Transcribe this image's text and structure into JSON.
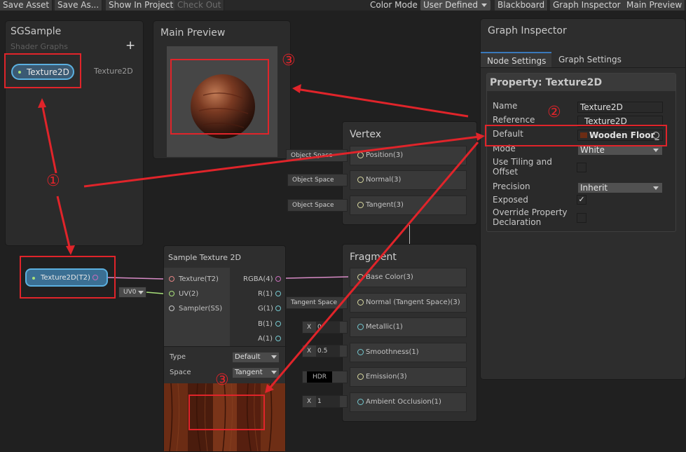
{
  "toolbar": {
    "save_asset": "Save Asset",
    "save_as": "Save As...",
    "show_in_project": "Show In Project",
    "check_out": "Check Out",
    "color_mode_label": "Color Mode",
    "color_mode_value": "User Defined",
    "blackboard": "Blackboard",
    "graph_inspector": "Graph Inspector",
    "main_preview": "Main Preview"
  },
  "blackboard": {
    "title": "SGSample",
    "subtitle": "Shader Graphs",
    "add": "+",
    "property_pill": "Texture2D",
    "property_type": "Texture2D"
  },
  "main_preview": {
    "title": "Main Preview"
  },
  "vertex": {
    "title": "Vertex",
    "slots": [
      {
        "label": "Position(3)",
        "input": "Object Space"
      },
      {
        "label": "Normal(3)",
        "input": "Object Space"
      },
      {
        "label": "Tangent(3)",
        "input": "Object Space"
      }
    ]
  },
  "fragment": {
    "title": "Fragment",
    "slots": [
      {
        "label": "Base Color(3)",
        "input": ""
      },
      {
        "label": "Normal (Tangent Space)(3)",
        "input": "Tangent Space"
      },
      {
        "label": "Metallic(1)",
        "input_prefix": "X",
        "input": "0"
      },
      {
        "label": "Smoothness(1)",
        "input_prefix": "X",
        "input": "0.5"
      },
      {
        "label": "Emission(3)",
        "input": "HDR"
      },
      {
        "label": "Ambient Occlusion(1)",
        "input_prefix": "X",
        "input": "1"
      }
    ]
  },
  "property_node": {
    "label": "Texture2D(T2)"
  },
  "uv_input": "UV0",
  "sample_node": {
    "title": "Sample Texture 2D",
    "inputs": [
      "Texture(T2)",
      "UV(2)",
      "Sampler(SS)"
    ],
    "outputs": [
      "RGBA(4)",
      "R(1)",
      "G(1)",
      "B(1)",
      "A(1)"
    ],
    "type_label": "Type",
    "type_value": "Default",
    "space_label": "Space",
    "space_value": "Tangent"
  },
  "inspector": {
    "title": "Graph Inspector",
    "tab_node": "Node Settings",
    "tab_graph": "Graph Settings",
    "property_heading": "Property: Texture2D",
    "rows": {
      "name_label": "Name",
      "name_value": "Texture2D",
      "reference_label": "Reference",
      "reference_value": "_Texture2D",
      "default_label": "Default",
      "default_value": "Wooden Floor_",
      "mode_label": "Mode",
      "mode_value": "White",
      "tiling_label": "Use Tiling and Offset",
      "precision_label": "Precision",
      "precision_value": "Inherit",
      "exposed_label": "Exposed",
      "override_label": "Override Property Declaration"
    },
    "exposed_checked": true
  },
  "annotations": [
    "①",
    "②",
    "③",
    "③"
  ],
  "colors": {
    "annotation_red": "#e0242a",
    "accent_blue": "#3a79bb",
    "pill_blue": "#4a9bc7"
  }
}
